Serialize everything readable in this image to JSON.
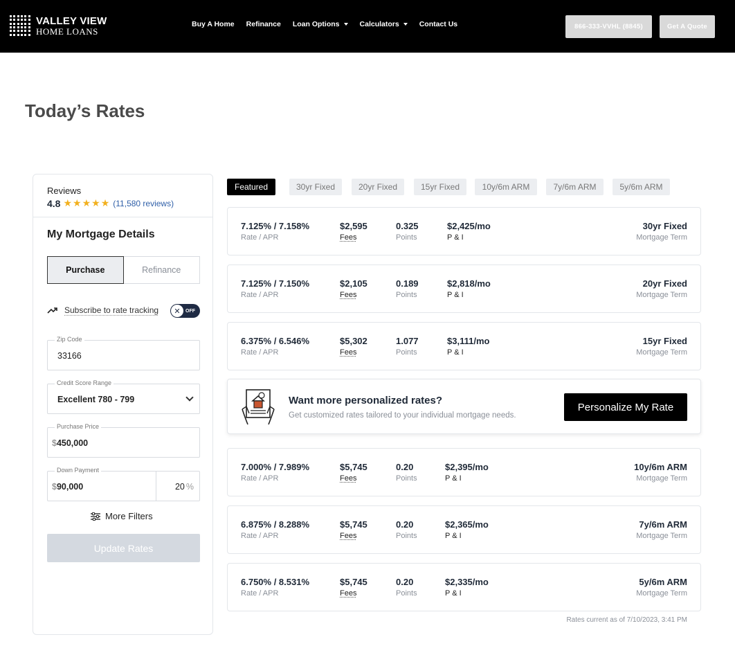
{
  "header": {
    "logo_line1": "VALLEY VIEW",
    "logo_line2": "HOME LOANS",
    "nav": [
      {
        "label": "Buy A Home",
        "dropdown": false
      },
      {
        "label": "Refinance",
        "dropdown": false
      },
      {
        "label": "Loan Options",
        "dropdown": true
      },
      {
        "label": "Calculators",
        "dropdown": true
      },
      {
        "label": "Contact Us",
        "dropdown": false
      }
    ],
    "phone_button": "866-333-VVHL (8845)",
    "quote_button": "Get A Quote"
  },
  "page_title": "Today’s Rates",
  "sidebar": {
    "reviews_label": "Reviews",
    "rating": "4.8",
    "stars": 5,
    "review_count": "(11,580 reviews)",
    "details_title": "My Mortgage Details",
    "purpose_options": [
      "Purchase",
      "Refinance"
    ],
    "purpose_selected": "Purchase",
    "subscribe_label": "Subscribe to rate tracking",
    "toggle_text": "OFF",
    "zip": {
      "label": "Zip Code",
      "value": "33166"
    },
    "credit": {
      "label": "Credit Score Range",
      "value": "Excellent 780 - 799"
    },
    "price": {
      "label": "Purchase Price",
      "prefix": "$",
      "value": "450,000"
    },
    "down": {
      "label": "Down Payment",
      "prefix": "$",
      "value": "90,000",
      "percent": "20",
      "percent_sign": "%"
    },
    "more_filters": "More Filters",
    "update_button": "Update Rates"
  },
  "tabs": [
    "Featured",
    "30yr Fixed",
    "20yr Fixed",
    "15yr Fixed",
    "10y/6m ARM",
    "7y/6m ARM",
    "5y/6m ARM"
  ],
  "active_tab": "Featured",
  "labels": {
    "rate": "Rate / APR",
    "fees": "Fees",
    "points": "Points",
    "payment": "P & I",
    "term": "Mortgage Term"
  },
  "rates": [
    {
      "rate_apr": "7.125% / 7.158%",
      "fees": "$2,595",
      "points": "0.325",
      "payment": "$2,425/mo",
      "term": "30yr Fixed"
    },
    {
      "rate_apr": "7.125% / 7.150%",
      "fees": "$2,105",
      "points": "0.189",
      "payment": "$2,818/mo",
      "term": "20yr Fixed"
    },
    {
      "rate_apr": "6.375% / 6.546%",
      "fees": "$5,302",
      "points": "1.077",
      "payment": "$3,111/mo",
      "term": "15yr Fixed"
    },
    {
      "rate_apr": "7.000% / 7.989%",
      "fees": "$5,745",
      "points": "0.20",
      "payment": "$2,395/mo",
      "term": "10y/6m ARM"
    },
    {
      "rate_apr": "6.875% / 8.288%",
      "fees": "$5,745",
      "points": "0.20",
      "payment": "$2,365/mo",
      "term": "7y/6m ARM"
    },
    {
      "rate_apr": "6.750% / 8.531%",
      "fees": "$5,745",
      "points": "0.20",
      "payment": "$2,335/mo",
      "term": "5y/6m ARM"
    }
  ],
  "promo": {
    "title": "Want more personalized rates?",
    "subtitle": "Get customized rates tailored to your individual mortgage needs.",
    "button": "Personalize My Rate"
  },
  "as_of": "Rates current as of 7/10/2023, 3:41 PM",
  "colors": {
    "accent": "#000000",
    "star": "#f2b01e",
    "link": "#2f5fa8",
    "toggle": "#1f2b44",
    "disabled": "#d4d9e0"
  }
}
